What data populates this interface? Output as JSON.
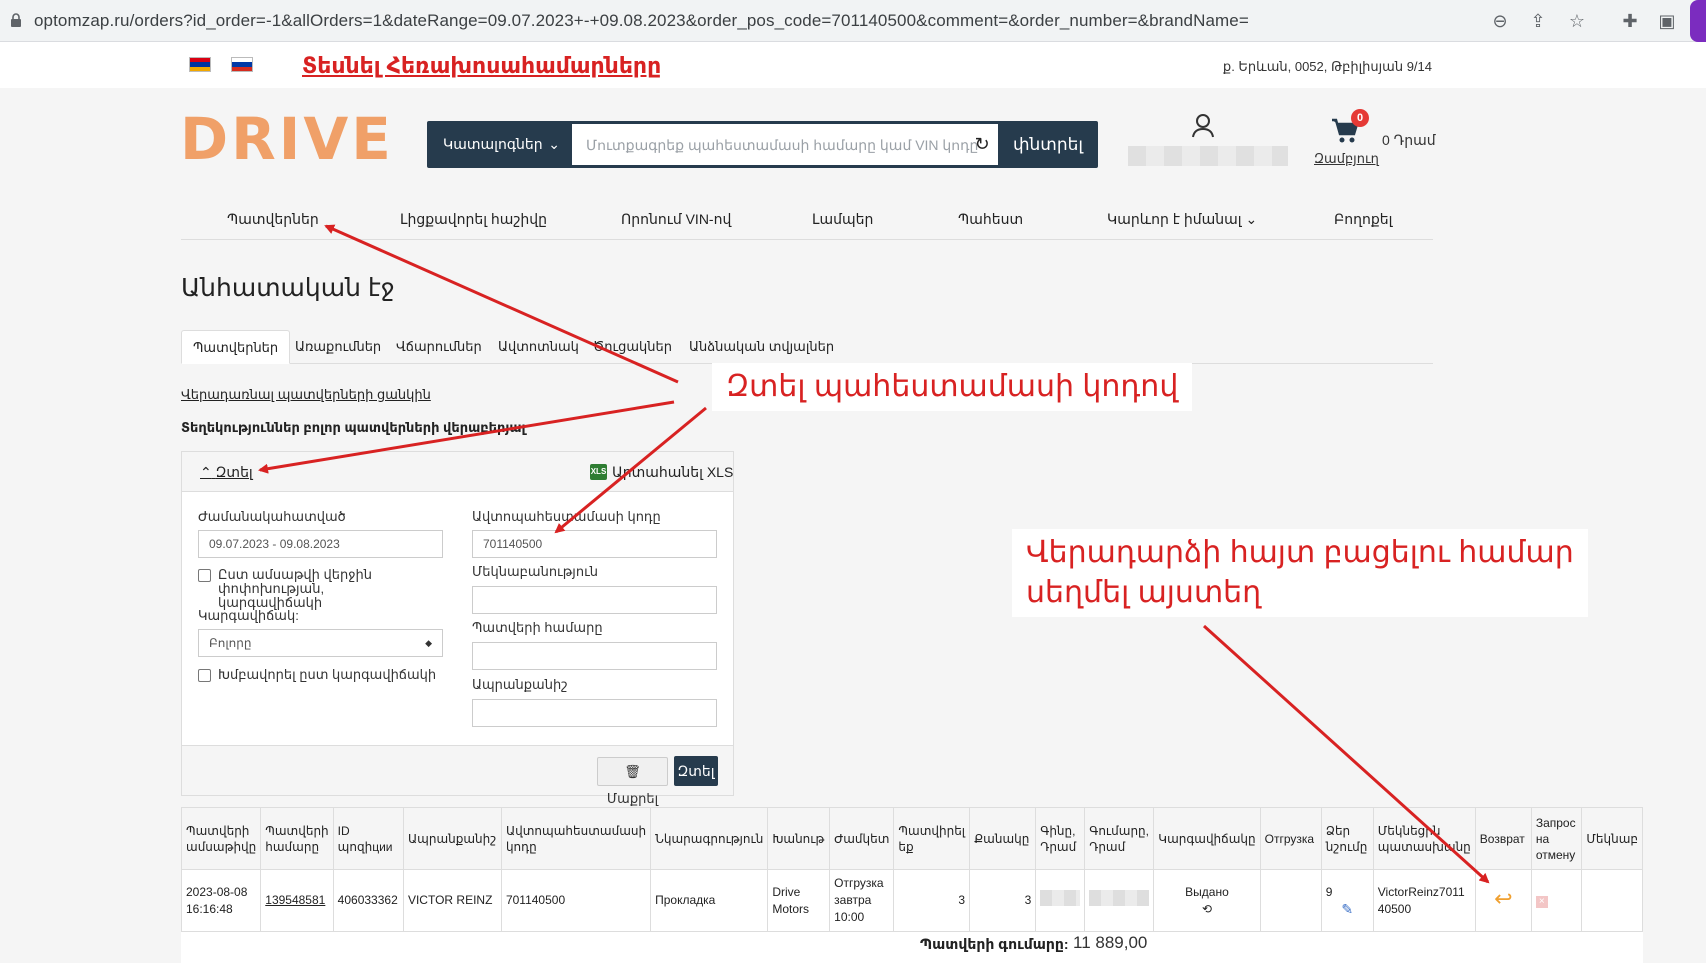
{
  "browser": {
    "url": "optomzap.ru/orders?id_order=-1&allOrders=1&dateRange=09.07.2023+-+09.08.2023&order_pos_code=701140500&comment=&order_number=&brandName="
  },
  "topbar": {
    "view_link": "Տեսնել Հեռախոսահամարները",
    "address": "ք. Երևան, 0052, Թբիլիսյան 9/14"
  },
  "header": {
    "logo": "DRIVE",
    "catalogs_label": "Կատալոգներ",
    "search_placeholder": "Մուտքագրեք պահեստամասի համարը կամ VIN կոդը",
    "search_button": "փնտրել",
    "cart_count": "0",
    "cart_total": "0 Դրամ",
    "cart_label": "Զամբյուղ"
  },
  "nav": {
    "items": [
      "Պատվերներ",
      "Լիցքավորել հաշիվը",
      "Որոնում VIN-ով",
      "Լամպեր",
      "Պահեստ",
      "Կարևոր է իմանալ",
      "Բողոքել"
    ]
  },
  "page": {
    "title": "Անհատական էջ",
    "tabs": [
      "Պատվերներ",
      "Առաքումներ",
      "Վճարումներ",
      "Ավտոտնակ",
      "Ծուցակներ",
      "Անձնական տվյալներ"
    ],
    "back_link": "Վերադառնալ պատվերների ցանկին",
    "info_heading": "Տեղեկություններ բոլոր պատվերների վերաբերյալ"
  },
  "filter": {
    "toggle_label": "Զտել",
    "export_label": "Արտահանել XLS",
    "xls_badge": "XLS",
    "period_label": "Ժամանակահատված",
    "period_value": "09.07.2023 - 09.08.2023",
    "by_date_label": "Ըստ ամսաթվի վերջին փոփոխության, կարգավիճակի",
    "status_label": "Կարգավիճակ:",
    "status_value": "Բոլորը",
    "group_label": "Խմբավորել ըստ կարգավիճակի",
    "part_code_label": "Ավտոպահեստամասի կոդը",
    "part_code_value": "701140500",
    "comment_label": "Մեկնաբանություն",
    "comment_value": "",
    "order_number_label": "Պատվերի համարը",
    "order_number_value": "",
    "brand_label": "Ապրանքանիշ",
    "brand_value": "",
    "reset_button": "Մաքրել",
    "apply_button": "Զտել"
  },
  "table": {
    "headers": [
      "Պատվերի ամսաթիվը",
      "Պատվերի համարը",
      "ID պոզիции",
      "Ապրանքանիշ",
      "Ավտոպահեստամասի կոդը",
      "Նկարագրություն",
      "Խանութ",
      "Ժամկետ",
      "Պատվիրել եք",
      "Քանակը",
      "Գինը, Դրամ",
      "Գումարը, Դրամ",
      "Կարգավիճակը",
      "Отгрузка",
      "Ձեր նշումը",
      "Մեկնեցին պատասխանը",
      "Возврат",
      "Запрос на отмену",
      "Մեկնաբ"
    ],
    "rows": [
      {
        "date": "2023-08-08 16:16:48",
        "order_number": "139548581",
        "position_id": "406033362",
        "brand": "VICTOR REINZ",
        "part_code": "701140500",
        "description": "Прокладка",
        "store": "Drive Motors",
        "term": "Отгрузка завтра 10:00",
        "ordered": "3",
        "quantity": "3",
        "status": "Выдано",
        "note": "9",
        "reply": "VictorReinz701140500"
      }
    ],
    "total_label": "Պատվերի գումարը:",
    "total_value": "11 889,00"
  },
  "annotations": {
    "filter_by_code": "Զտել պահեստամասի կոդով",
    "return_hint": [
      "Վերադարձի հայտ բացելու համար",
      "սեղմել այստեղ"
    ]
  },
  "colors": {
    "accent_dark": "#263b4d",
    "annotation_red": "#d82222",
    "logo_orange": "#f0a068"
  }
}
